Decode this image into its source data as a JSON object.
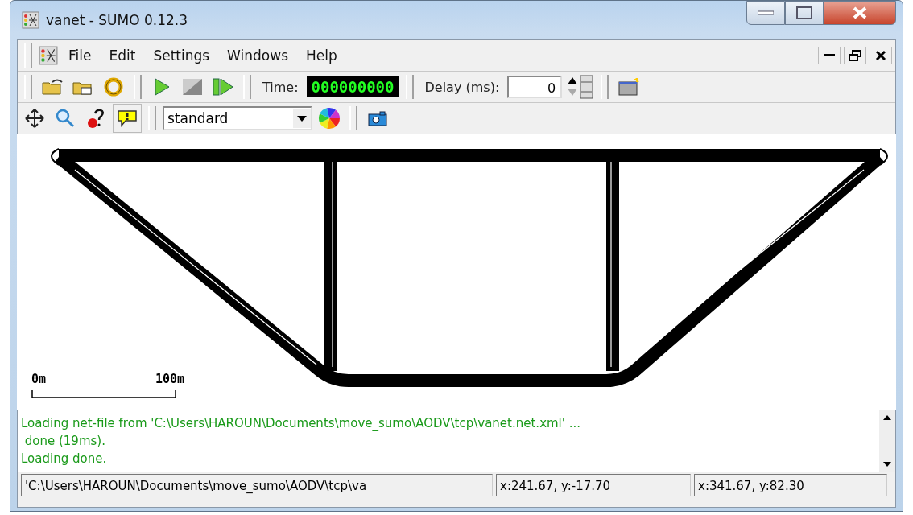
{
  "window": {
    "title": "vanet - SUMO 0.12.3"
  },
  "menu": [
    {
      "label": "File"
    },
    {
      "label": "Edit"
    },
    {
      "label": "Settings"
    },
    {
      "label": "Windows"
    },
    {
      "label": "Help"
    }
  ],
  "toolbar": {
    "time_label": "Time:",
    "time_value": "000000000",
    "delay_label": "Delay (ms):",
    "delay_value": "0"
  },
  "view_toolbar": {
    "scheme": "standard"
  },
  "canvas": {
    "scale_start": "0m",
    "scale_end": "100m"
  },
  "log": [
    "Loading net-file from 'C:\\Users\\HAROUN\\Documents\\move_sumo\\AODV\\tcp\\vanet.net.xml' ...",
    "done (19ms).",
    "Loading done."
  ],
  "status_bar": [
    "'C:\\Users\\HAROUN\\Documents\\move_sumo\\AODV\\tcp\\va",
    "x:241.67, y:-17.70",
    "x:341.67, y:82.30"
  ]
}
